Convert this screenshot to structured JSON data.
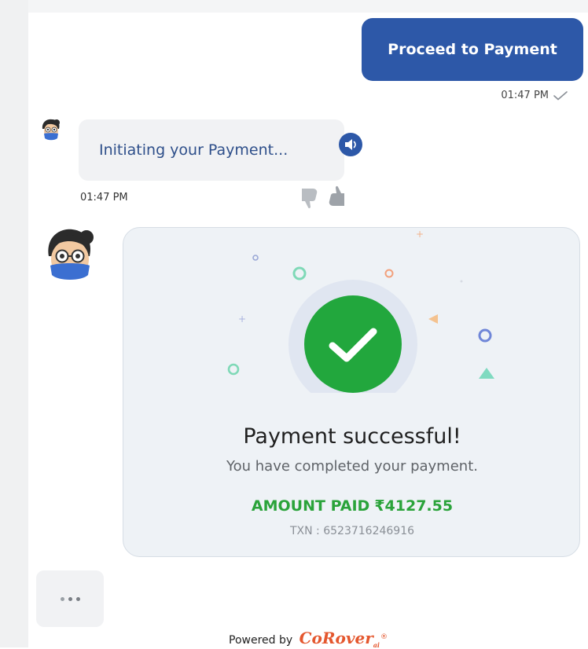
{
  "user_message": {
    "text": "Proceed to Payment",
    "time": "01:47 PM",
    "status_icon": "single-check-icon"
  },
  "bot_message": {
    "text": "Initiating your Payment...",
    "time": "01:47 PM",
    "speaker_icon": "speaker-icon",
    "feedback_icons": [
      "thumbs-down-icon",
      "thumbs-up-icon"
    ]
  },
  "payment_card": {
    "status_icon": "check-circle-icon",
    "title": "Payment successful!",
    "subtitle": "You have completed your payment.",
    "amount_label": "AMOUNT PAID",
    "amount_value": "₹4127.55",
    "txn": "TXN : 6523716246916"
  },
  "typing_indicator": {
    "icon": "typing-dots-icon"
  },
  "footer": {
    "powered_label": "Powered by",
    "brand_name": "CoRover",
    "brand_suffix": "ai",
    "registered_mark": "®"
  },
  "colors": {
    "user_bubble": "#2d58a8",
    "bot_text": "#2e4f8a",
    "success_green": "#2aa33a",
    "success_circle": "#22a73d",
    "brand_orange": "#e4572e",
    "card_bg": "#eef2f6"
  }
}
